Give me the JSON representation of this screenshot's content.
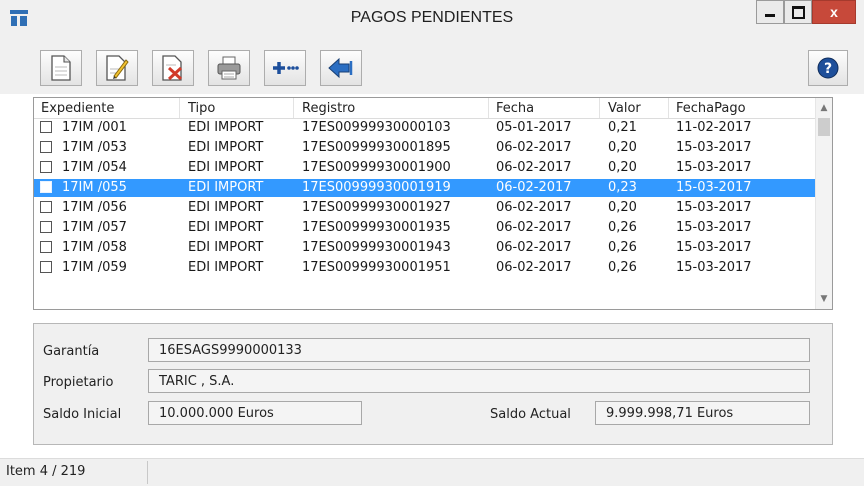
{
  "window": {
    "title": "PAGOS PENDIENTES",
    "close_glyph": "x"
  },
  "toolbar": {
    "buttons": [
      {
        "icon": "new-document-icon"
      },
      {
        "icon": "edit-document-icon"
      },
      {
        "icon": "delete-document-icon"
      },
      {
        "icon": "printer-icon"
      },
      {
        "icon": "more-options-icon"
      },
      {
        "icon": "exit-arrow-icon"
      }
    ],
    "help_icon": "help-icon"
  },
  "table": {
    "columns": [
      "Expediente",
      "Tipo",
      "Registro",
      "Fecha",
      "Valor",
      "FechaPago"
    ],
    "rows": [
      [
        "17IM /001",
        "EDI IMPORT",
        "17ES00999930000103",
        "05-01-2017",
        "0,21",
        "11-02-2017"
      ],
      [
        "17IM /053",
        "EDI IMPORT",
        "17ES00999930001895",
        "06-02-2017",
        "0,20",
        "15-03-2017"
      ],
      [
        "17IM /054",
        "EDI IMPORT",
        "17ES00999930001900",
        "06-02-2017",
        "0,20",
        "15-03-2017"
      ],
      [
        "17IM /055",
        "EDI IMPORT",
        "17ES00999930001919",
        "06-02-2017",
        "0,23",
        "15-03-2017"
      ],
      [
        "17IM /056",
        "EDI IMPORT",
        "17ES00999930001927",
        "06-02-2017",
        "0,20",
        "15-03-2017"
      ],
      [
        "17IM /057",
        "EDI IMPORT",
        "17ES00999930001935",
        "06-02-2017",
        "0,26",
        "15-03-2017"
      ],
      [
        "17IM /058",
        "EDI IMPORT",
        "17ES00999930001943",
        "06-02-2017",
        "0,26",
        "15-03-2017"
      ],
      [
        "17IM /059",
        "EDI IMPORT",
        "17ES00999930001951",
        "06-02-2017",
        "0,26",
        "15-03-2017"
      ]
    ],
    "selected_index": 3,
    "selected_color": "#3399ff"
  },
  "info": {
    "garantia_label": "Garantía",
    "garantia_value": "16ESAGS9990000133",
    "propietario_label": "Propietario",
    "propietario_value": "TARIC , S.A.",
    "saldo_inicial_label": "Saldo Inicial",
    "saldo_inicial_value": "10.000.000  Euros",
    "saldo_actual_label": "Saldo Actual",
    "saldo_actual_value": "9.999.998,71  Euros"
  },
  "status": {
    "text": "Item 4 / 219"
  }
}
